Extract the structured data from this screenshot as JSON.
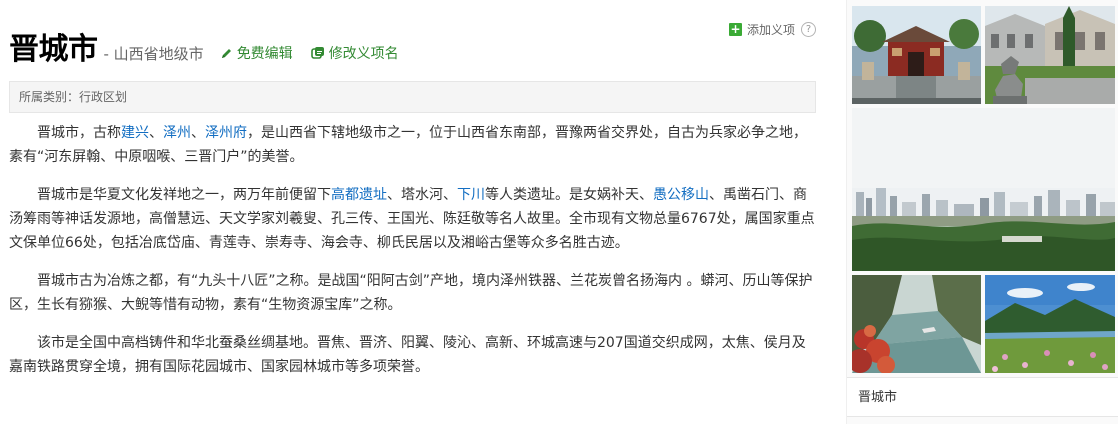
{
  "header": {
    "title": "晋城市",
    "subtitle": "- 山西省地级市",
    "edit_label": "免费编辑",
    "rename_label": "修改义项名"
  },
  "top_actions": {
    "add_sense_label": "添加义项",
    "help_symbol": "?"
  },
  "category": {
    "text": "所属类别：行政区划"
  },
  "paragraphs": [
    {
      "segments": [
        {
          "t": "晋城市，古称"
        },
        {
          "t": "建兴",
          "link": true
        },
        {
          "t": "、"
        },
        {
          "t": "泽州",
          "link": true
        },
        {
          "t": "、"
        },
        {
          "t": "泽州府",
          "link": true
        },
        {
          "t": "，是山西省下辖地级市之一，位于山西省东南部，晋豫两省交界处，自古为兵家必争之地，素有“河东屏翰、中原咽喉、三晋门户”的美誉。"
        }
      ]
    },
    {
      "segments": [
        {
          "t": "晋城市是华夏文化发祥地之一，两万年前便留下"
        },
        {
          "t": "高都遗址",
          "link": true
        },
        {
          "t": "、塔水河、"
        },
        {
          "t": "下川",
          "link": true
        },
        {
          "t": "等人类遗址。是女娲补天、"
        },
        {
          "t": "愚公移山",
          "link": true
        },
        {
          "t": "、禹凿石门、商汤筹雨等神话发源地，高僧慧远、天文学家刘羲叟、孔三传、王国光、陈廷敬等名人故里。全市现有文物总量6767处，属国家重点文保单位66处，包括冶底岱庙、青莲寺、崇寿寺、海会寺、柳氏民居以及湘峪古堡等众多名胜古迹。"
        }
      ]
    },
    {
      "segments": [
        {
          "t": "晋城市古为冶炼之都，有“九头十八匠”之称。是战国“阳阿古剑”产地，境内泽州铁器、兰花炭曾名扬海内 。蟒河、历山等保护区，生长有猕猴、大鲵等惜有动物，素有“生物资源宝库”之称。"
        }
      ]
    },
    {
      "segments": [
        {
          "t": "该市是全国中高档铸件和华北蚕桑丝绸基地。晋焦、晋济、阳翼、陵沁、高新、环城高速与207国道交织成网，太焦、侯月及嘉南铁路贯穿全境，拥有国际花园城市、国家园林城市等多项荣誉。"
        }
      ]
    }
  ],
  "sidebar": {
    "caption": "晋城市",
    "photos": [
      {
        "name": "temple-gate-photo"
      },
      {
        "name": "stone-lion-courtyard-photo"
      },
      {
        "name": "city-skyline-photo"
      },
      {
        "name": "river-gorge-photo"
      },
      {
        "name": "mountain-lake-photo"
      }
    ]
  },
  "icons": {
    "edit": "pencil-icon",
    "rename": "rename-icon",
    "add": "plus-icon",
    "help": "help-icon"
  },
  "colors": {
    "link": "#136ec2",
    "action_green": "#338a33",
    "add_green": "#3aaa35"
  }
}
